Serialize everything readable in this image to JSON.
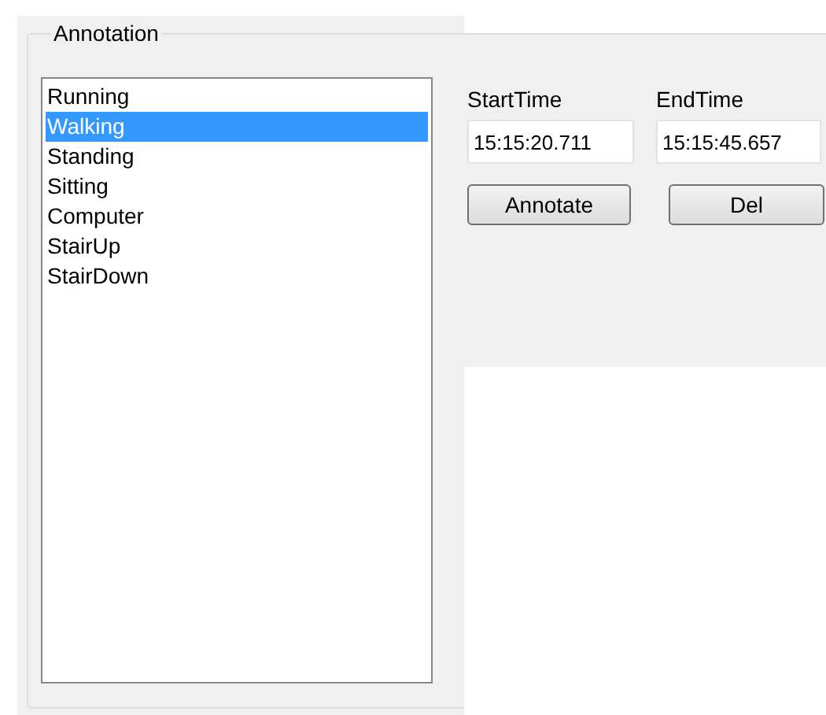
{
  "group": {
    "title": "Annotation"
  },
  "activities": [
    {
      "label": "Running",
      "selected": false
    },
    {
      "label": "Walking",
      "selected": true
    },
    {
      "label": "Standing",
      "selected": false
    },
    {
      "label": "Sitting",
      "selected": false
    },
    {
      "label": "Computer",
      "selected": false
    },
    {
      "label": "StairUp",
      "selected": false
    },
    {
      "label": "StairDown",
      "selected": false
    }
  ],
  "start_time": {
    "label": "StartTime",
    "value": "15:15:20.711"
  },
  "end_time": {
    "label": "EndTime",
    "value": "15:15:45.657"
  },
  "buttons": [
    "Annotate",
    "Del"
  ]
}
